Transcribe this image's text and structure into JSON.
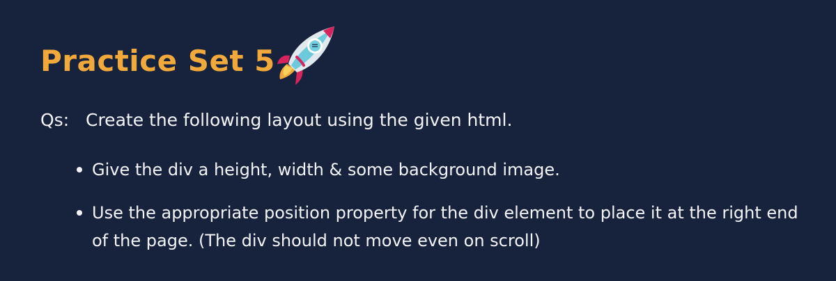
{
  "slide": {
    "title": "Practice Set 5",
    "title_icon": "rocket-icon",
    "question_label": "Qs:",
    "question_text": "Create the following layout using the given html.",
    "bullets": [
      {
        "text": "Give the div a height, width & some background image."
      },
      {
        "text": "Use the appropriate position property for the div element to place it at the right end of the page. (The div should not move even on scroll)"
      }
    ]
  },
  "colors": {
    "background": "#17233d",
    "title": "#f2a93b",
    "text": "#f3f4f7"
  }
}
